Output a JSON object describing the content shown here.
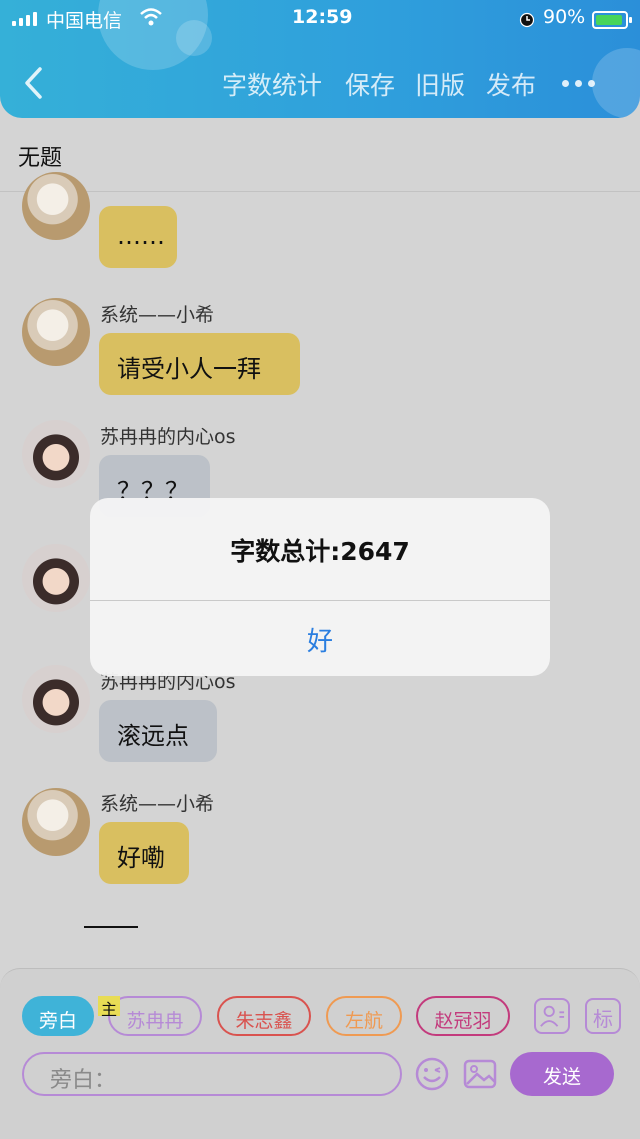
{
  "status": {
    "carrier": "中国电信",
    "time": "12:59",
    "battery": "90%"
  },
  "header": {
    "nav": [
      "字数统计",
      "保存",
      "旧版",
      "发布"
    ]
  },
  "doc_title": "无题",
  "messages": [
    {
      "name": "",
      "text": "……",
      "style": "yellow"
    },
    {
      "name": "系统——小希",
      "text": "请受小人一拜",
      "style": "yellow"
    },
    {
      "name": "苏冉冉的内心os",
      "text": "？？？",
      "style": "gray"
    },
    {
      "name": "苏冉冉的内心os",
      "text": "滚远点",
      "style": "gray"
    },
    {
      "name": "系统——小希",
      "text": "好嘞",
      "style": "yellow"
    }
  ],
  "alert": {
    "message": "字数总计:2647",
    "ok": "好"
  },
  "composer": {
    "roles": [
      {
        "label": "旁白",
        "color": "#3fb3d8"
      },
      {
        "label": "苏冉冉",
        "color": "#b68ad6"
      },
      {
        "label": "朱志鑫",
        "color": "#d9534f"
      },
      {
        "label": "左航",
        "color": "#ef9a52"
      },
      {
        "label": "赵冠羽",
        "color": "#c33b7d"
      }
    ],
    "main_badge": "主",
    "tag_button": "标",
    "input_placeholder": "旁白：",
    "send": "发送"
  }
}
